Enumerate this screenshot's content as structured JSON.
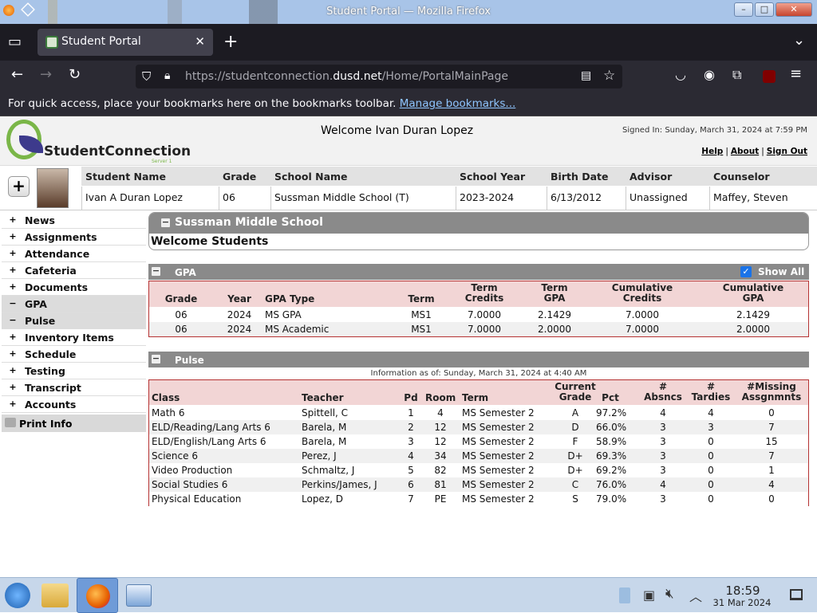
{
  "window": {
    "title": "Student Portal — Mozilla Firefox"
  },
  "browser": {
    "tab_label": "Student Portal",
    "url_prefix": "https://studentconnection.",
    "url_domain": "dusd.net",
    "url_path": "/Home/PortalMainPage",
    "bookmarks_text": "For quick access, place your bookmarks here on the bookmarks toolbar.",
    "bookmarks_link": "Manage bookmarks..."
  },
  "header": {
    "logo_text": "StudentConnection",
    "logo_sub": "Server 1",
    "welcome": "Welcome Ivan Duran Lopez",
    "signed_in": "Signed In: Sunday, March 31, 2024 at 7:59 PM",
    "links": [
      "Help",
      "About",
      "Sign Out"
    ]
  },
  "student": {
    "headers": [
      "Student Name",
      "Grade",
      "School Name",
      "School Year",
      "Birth Date",
      "Advisor",
      "Counselor"
    ],
    "values": [
      "Ivan A Duran Lopez",
      "06",
      "Sussman Middle School (T)",
      "2023-2024",
      "6/13/2012",
      "Unassigned",
      "Maffey, Steven"
    ]
  },
  "nav": {
    "items": [
      {
        "label": "News",
        "sign": "+"
      },
      {
        "label": "Assignments",
        "sign": "+"
      },
      {
        "label": "Attendance",
        "sign": "+"
      },
      {
        "label": "Cafeteria",
        "sign": "+"
      },
      {
        "label": "Documents",
        "sign": "+"
      },
      {
        "label": "GPA",
        "sign": "−"
      },
      {
        "label": "Pulse",
        "sign": "−"
      },
      {
        "label": "Inventory Items",
        "sign": "+"
      },
      {
        "label": "Schedule",
        "sign": "+"
      },
      {
        "label": "Testing",
        "sign": "+"
      },
      {
        "label": "Transcript",
        "sign": "+"
      },
      {
        "label": "Accounts",
        "sign": "+"
      }
    ],
    "print_label": "Print Info"
  },
  "school": {
    "title": "Sussman Middle School",
    "welcome": "Welcome Students"
  },
  "gpa": {
    "title": "GPA",
    "show_all": "Show All",
    "headers": [
      "Grade",
      "Year",
      "GPA Type",
      "Term",
      "Term\nCredits",
      "Term\nGPA",
      "Cumulative\nCredits",
      "Cumulative\nGPA"
    ],
    "rows": [
      [
        "06",
        "2024",
        "MS GPA",
        "MS1",
        "7.0000",
        "2.1429",
        "7.0000",
        "2.1429"
      ],
      [
        "06",
        "2024",
        "MS Academic",
        "MS1",
        "7.0000",
        "2.0000",
        "7.0000",
        "2.0000"
      ]
    ]
  },
  "pulse": {
    "title": "Pulse",
    "info": "Information as of: Sunday, March 31, 2024 at 4:40 AM",
    "headers": [
      "Class",
      "Teacher",
      "Pd",
      "Room",
      "Term",
      "Current\nGrade",
      "Pct",
      "#\nAbsncs",
      "#\nTardies",
      "#Missing\nAssgnmnts"
    ],
    "rows": [
      [
        "Math 6",
        "Spittell, C",
        "1",
        "4",
        "MS Semester 2",
        "A",
        "97.2%",
        "4",
        "4",
        "0"
      ],
      [
        "ELD/Reading/Lang Arts 6",
        "Barela, M",
        "2",
        "12",
        "MS Semester 2",
        "D",
        "66.0%",
        "3",
        "3",
        "7"
      ],
      [
        "ELD/English/Lang Arts 6",
        "Barela, M",
        "3",
        "12",
        "MS Semester 2",
        "F",
        "58.9%",
        "3",
        "0",
        "15"
      ],
      [
        "Science 6",
        "Perez, J",
        "4",
        "34",
        "MS Semester 2",
        "D+",
        "69.3%",
        "3",
        "0",
        "7"
      ],
      [
        "Video Production",
        "Schmaltz, J",
        "5",
        "82",
        "MS Semester 2",
        "D+",
        "69.2%",
        "3",
        "0",
        "1"
      ],
      [
        "Social Studies 6",
        "Perkins/James, J",
        "6",
        "81",
        "MS Semester 2",
        "C",
        "76.0%",
        "4",
        "0",
        "4"
      ],
      [
        "Physical Education",
        "Lopez, D",
        "7",
        "PE",
        "MS Semester 2",
        "S",
        "79.0%",
        "3",
        "0",
        "0"
      ]
    ]
  },
  "taskbar": {
    "time": "18:59",
    "date": "31 Mar 2024"
  },
  "colors": {
    "accent_red": "#b53232",
    "section_grey": "#8a8a8a",
    "header_pink": "#f2d5d5"
  }
}
